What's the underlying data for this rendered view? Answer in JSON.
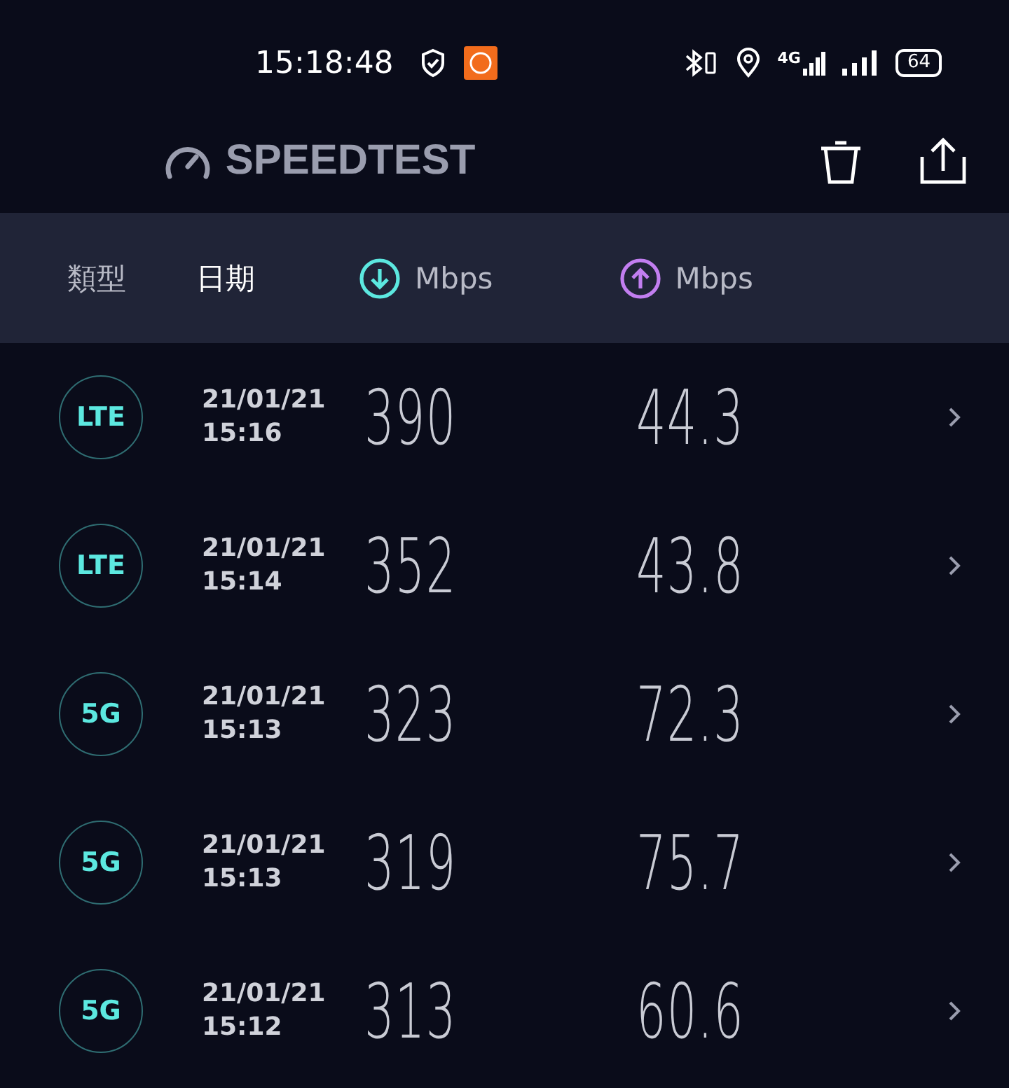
{
  "status_bar": {
    "time": "15:18:48",
    "battery": "64",
    "network": "4G"
  },
  "app_bar": {
    "title": "SPEEDTEST"
  },
  "columns": [
    {
      "label": "類型",
      "kind": "text",
      "selected": false
    },
    {
      "label": "日期",
      "kind": "text",
      "selected": true
    },
    {
      "label": "Mbps",
      "kind": "download",
      "selected": false
    },
    {
      "label": "Mbps",
      "kind": "upload",
      "selected": false
    }
  ],
  "results": [
    {
      "type": "LTE",
      "date": "21/01/21",
      "time": "15:16",
      "download": "390",
      "upload": "44.3"
    },
    {
      "type": "LTE",
      "date": "21/01/21",
      "time": "15:14",
      "download": "352",
      "upload": "43.8"
    },
    {
      "type": "5G",
      "date": "21/01/21",
      "time": "15:13",
      "download": "323",
      "upload": "72.3"
    },
    {
      "type": "5G",
      "date": "21/01/21",
      "time": "15:13",
      "download": "319",
      "upload": "75.7"
    },
    {
      "type": "5G",
      "date": "21/01/21",
      "time": "15:12",
      "download": "313",
      "upload": "60.6"
    }
  ]
}
